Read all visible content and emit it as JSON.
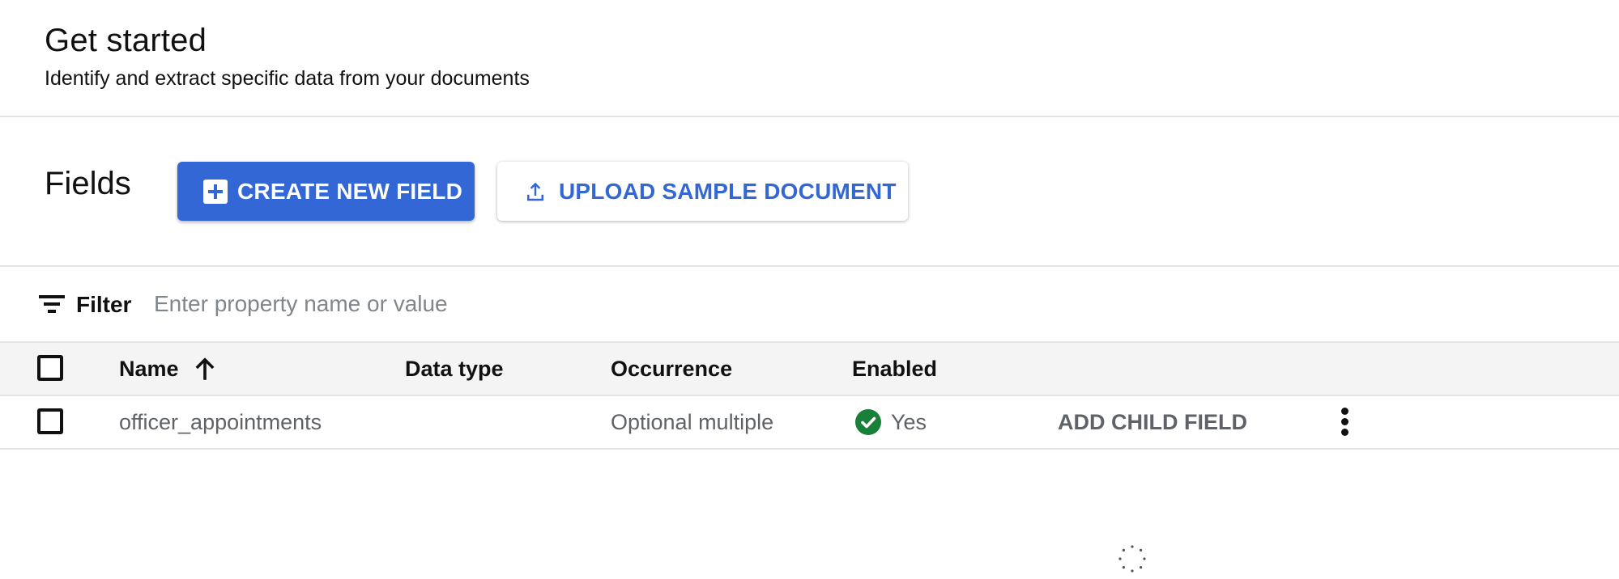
{
  "header": {
    "title": "Get started",
    "subtitle": "Identify and extract specific data from your documents"
  },
  "fields_bar": {
    "title": "Fields",
    "create_button": {
      "label": "CREATE NEW FIELD",
      "icon": "add-box-icon"
    },
    "upload_button": {
      "label": "UPLOAD SAMPLE DOCUMENT",
      "icon": "upload-icon"
    }
  },
  "filter": {
    "icon": "filter-list-icon",
    "label": "Filter",
    "value": "",
    "placeholder": "Enter property name or value"
  },
  "table": {
    "columns": [
      {
        "label": "Name",
        "sort": "ascending",
        "sort_icon": "arrow-upward-icon"
      },
      {
        "label": "Data type"
      },
      {
        "label": "Occurrence"
      },
      {
        "label": "Enabled"
      }
    ],
    "rows": [
      {
        "selected": false,
        "name": "officer_appointments",
        "data_type": "",
        "occurrence": "Optional multiple",
        "enabled": "Yes",
        "enabled_icon": "check-circle-icon",
        "action": "ADD CHILD FIELD",
        "menu_icon": "more-vert-icon"
      }
    ]
  },
  "loading": {
    "icon": "loading-spinner-icon"
  },
  "colors": {
    "primary": "#3367d6",
    "success": "#188038",
    "header_band": "#f4f4f4",
    "divider": "#e4e4e4",
    "placeholder": "#80868b",
    "secondary_text": "#5f6368"
  }
}
